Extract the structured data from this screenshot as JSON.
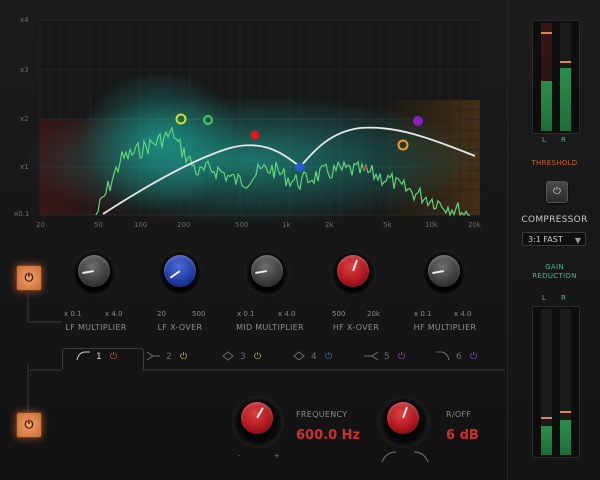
{
  "analyzer": {
    "y_labels": [
      "x4",
      "x3",
      "x2",
      "x1",
      "x0.1"
    ],
    "x_labels": [
      "20",
      "50",
      "100",
      "200",
      "500",
      "1k",
      "2k",
      "5k",
      "10k",
      "20k"
    ]
  },
  "knobs": [
    {
      "label": "LF MULTIPLIER",
      "min": "x 0.1",
      "max": "x 4.0",
      "color": "grey"
    },
    {
      "label": "LF X-OVER",
      "min": "20",
      "max": "500",
      "color": "blue"
    },
    {
      "label": "MID MULTIPLIER",
      "min": "x 0.1",
      "max": "x 4.0",
      "color": "grey"
    },
    {
      "label": "HF X-OVER",
      "min": "500",
      "max": "20k",
      "color": "red"
    },
    {
      "label": "HF MULTIPLIER",
      "min": "x 0.1",
      "max": "x 4.0",
      "color": "grey"
    }
  ],
  "tabs": [
    "1",
    "2",
    "3",
    "4",
    "5",
    "6"
  ],
  "band": {
    "frequency_label": "FREQUENCY",
    "frequency_value": "600.0 Hz",
    "roff_label": "R/OFF",
    "roff_value": "6 dB",
    "minus": "-",
    "plus": "+"
  },
  "right_panel": {
    "meter_l": "L",
    "meter_r": "R",
    "threshold_label": "THRESHOLD",
    "compressor_label": "COMPRESSOR",
    "compressor_mode": "3:1 FAST",
    "gain_reduction_line1": "GAIN",
    "gain_reduction_line2": "REDUCTION",
    "gr_l": "L",
    "gr_r": "R"
  },
  "icons": {
    "power": "⏻"
  },
  "colors": {
    "accent_red": "#d0302b",
    "meter_green": "#2a8f4a",
    "threshold_orange": "#e08a35",
    "curve": "#e8e8e8",
    "spectrum": "#5fd67a"
  }
}
